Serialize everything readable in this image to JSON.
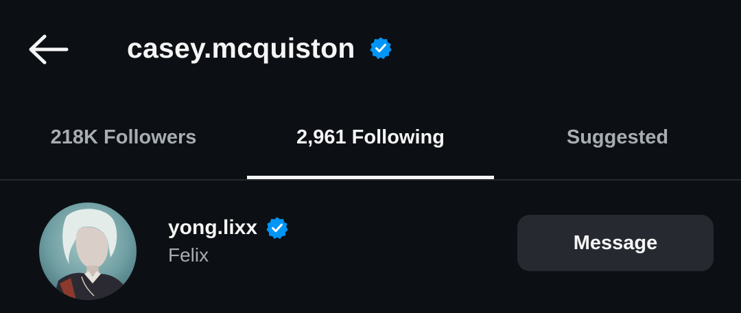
{
  "header": {
    "title": "casey.mcquiston",
    "verified": true
  },
  "tabs": [
    {
      "label": "218K Followers",
      "active": false
    },
    {
      "label": "2,961 Following",
      "active": true
    },
    {
      "label": "Suggested",
      "active": false
    }
  ],
  "list": [
    {
      "username": "yong.lixx",
      "full_name": "Felix",
      "verified": true,
      "action_label": "Message"
    }
  ],
  "colors": {
    "background": "#0c1014",
    "verified_blue": "#0095f6",
    "text_primary": "#f5f5f5",
    "text_secondary": "#a8adb3",
    "button_bg": "#262a30"
  },
  "icons": {
    "back": "arrow-left-icon",
    "verified": "verified-badge-icon"
  }
}
